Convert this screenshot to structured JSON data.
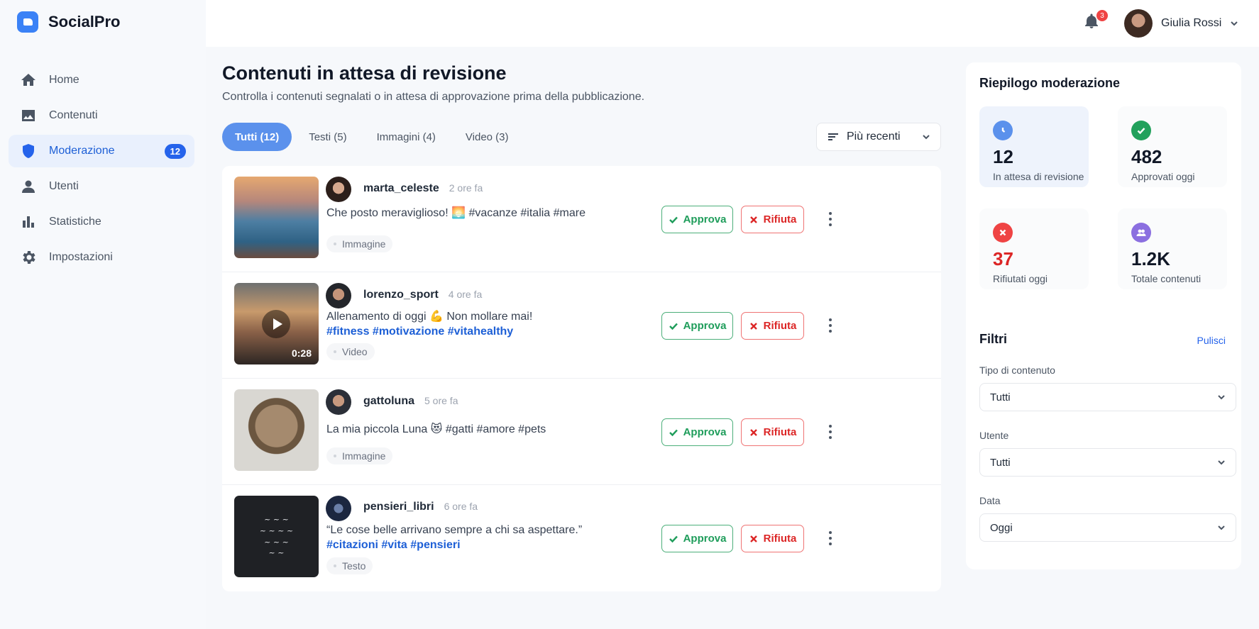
{
  "app": {
    "name": "SocialPro"
  },
  "sidebar": {
    "items": [
      {
        "label": "Home",
        "icon": "home-icon"
      },
      {
        "label": "Contenuti",
        "icon": "image-icon"
      },
      {
        "label": "Moderazione",
        "icon": "shield-icon",
        "badge": "12",
        "active": true
      },
      {
        "label": "Utenti",
        "icon": "user-icon"
      },
      {
        "label": "Statistiche",
        "icon": "bar-chart-icon"
      },
      {
        "label": "Impostazioni",
        "icon": "gear-icon"
      }
    ]
  },
  "header": {
    "notifications_count": "3",
    "user_name": "Giulia Rossi"
  },
  "main": {
    "title": "Contenuti in attesa di revisione",
    "subtitle": "Controlla i contenuti segnalati o in attesa di approvazione prima della pubblicazione.",
    "tabs": [
      {
        "label": "Tutti (12)",
        "active": true
      },
      {
        "label": "Testi (5)"
      },
      {
        "label": "Immagini (4)"
      },
      {
        "label": "Video (3)"
      }
    ],
    "sort_label": "Più recenti",
    "approve_label": "Approva",
    "reject_label": "Rifiuta",
    "posts": [
      {
        "user": "marta_celeste",
        "time": "2 ore fa",
        "text": "Che posto meraviglioso! 🌅 #vacanze #italia #mare",
        "tags": "",
        "type": "Immagine"
      },
      {
        "user": "lorenzo_sport",
        "time": "4 ore fa",
        "text": "Allenamento di oggi 💪  Non mollare mai!",
        "tags": "#fitness #motivazione #vitahealthy",
        "type": "Video",
        "duration": "0:28"
      },
      {
        "user": "gattoluna",
        "time": "5 ore fa",
        "text": "La mia piccola Luna 😻  #gatti #amore #pets",
        "tags": "",
        "type": "Immagine"
      },
      {
        "user": "pensieri_libri",
        "time": "6 ore fa",
        "text": "“Le cose belle arrivano sempre a chi sa aspettare.”",
        "tags": "#citazioni #vita #pensieri",
        "type": "Testo"
      }
    ]
  },
  "summary": {
    "title": "Riepilogo moderazione",
    "stats": [
      {
        "value": "12",
        "label": "In attesa di revisione",
        "color": "#5b91ec"
      },
      {
        "value": "482",
        "label": "Approvati oggi",
        "color": "#22a15c"
      },
      {
        "value": "37",
        "label": "Rifiutati oggi",
        "color": "#ef4444"
      },
      {
        "value": "1.2K",
        "label": "Totale contenuti",
        "color": "#8b6fe0"
      }
    ]
  },
  "filters": {
    "title": "Filtri",
    "clear_label": "Pulisci",
    "type_label": "Tipo di contenuto",
    "type_value": "Tutti",
    "user_label": "Utente",
    "user_value": "Tutti",
    "date_label": "Data",
    "date_value": "Oggi"
  }
}
